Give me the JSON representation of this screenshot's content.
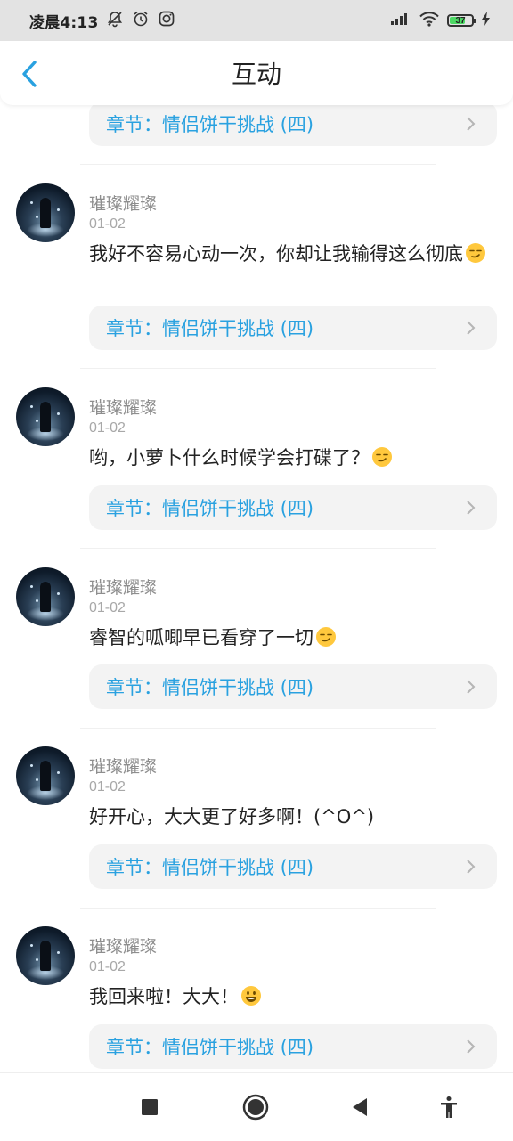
{
  "status_bar": {
    "time": "凌晨4:13",
    "battery": "37",
    "icons": [
      "bell-off-icon",
      "alarm-icon",
      "instagram-icon",
      "signal-icon",
      "wifi-icon",
      "battery-icon",
      "charging-icon"
    ]
  },
  "header": {
    "title": "互动",
    "back_icon": "chevron-left-icon",
    "accent_color": "#29a1e0"
  },
  "top_partial_chapter": {
    "label": "章节：情侣饼干挑战 (四)"
  },
  "comments": [
    {
      "username": "璀璨耀璨",
      "date": "01-02",
      "text": "我好不容易心动一次，你却让我输得这么彻底",
      "emoji": "smirk-emoji",
      "chapter": "章节：情侣饼干挑战 (四)"
    },
    {
      "username": "璀璨耀璨",
      "date": "01-02",
      "text": "哟，小萝卜什么时候学会打碟了？",
      "emoji": "smirk-emoji",
      "chapter": "章节：情侣饼干挑战 (四)"
    },
    {
      "username": "璀璨耀璨",
      "date": "01-02",
      "text": "睿智的呱唧早已看穿了一切",
      "emoji": "smirk-emoji",
      "chapter": "章节：情侣饼干挑战 (四)"
    },
    {
      "username": "璀璨耀璨",
      "date": "01-02",
      "text": "好开心，大大更了好多啊！(^O^)",
      "emoji": "",
      "chapter": "章节：情侣饼干挑战 (四)"
    },
    {
      "username": "璀璨耀璨",
      "date": "01-02",
      "text": "我回来啦！大大！",
      "emoji": "grin-emoji",
      "chapter": "章节：情侣饼干挑战 (四)"
    }
  ],
  "nav_bar": {
    "items": [
      "recents-square-icon",
      "home-circle-icon",
      "back-triangle-icon",
      "accessibility-icon"
    ]
  }
}
